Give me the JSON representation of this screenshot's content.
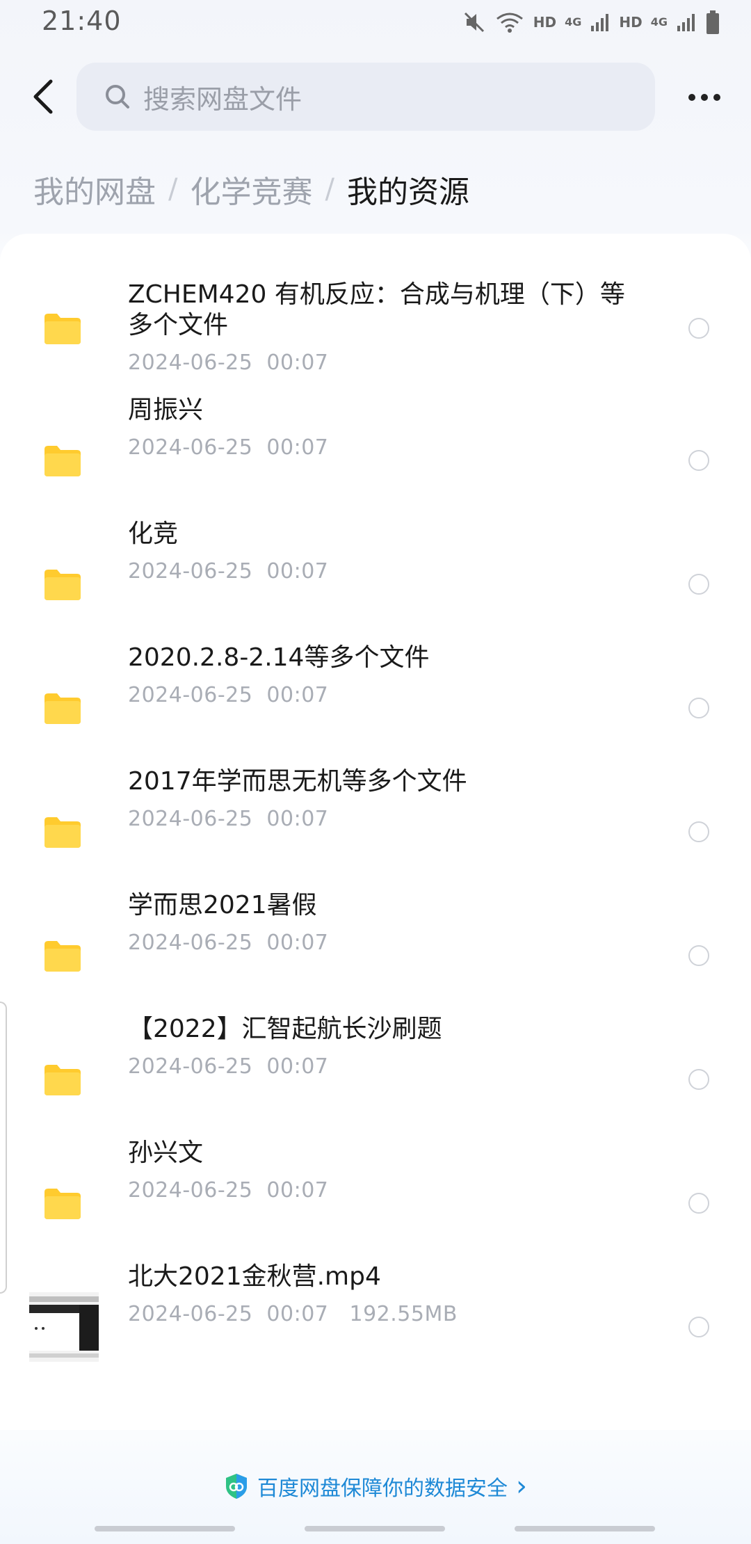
{
  "status_bar": {
    "time": "21:40",
    "hd_1": "HD",
    "net_1": "4G",
    "hd_2": "HD",
    "net_2": "4G"
  },
  "search": {
    "placeholder": "搜索网盘文件"
  },
  "breadcrumb": {
    "items": [
      "我的网盘",
      "化学竞赛",
      "我的资源"
    ]
  },
  "files": [
    {
      "name": "ZCHEM420 有机反应：合成与机理（下）等多个文件",
      "date": "2024-06-25  00:07",
      "type": "folder",
      "icon": "folder-icon"
    },
    {
      "name": "周振兴",
      "date": "2024-06-25  00:07",
      "type": "folder",
      "icon": "folder-icon"
    },
    {
      "name": "化竞",
      "date": "2024-06-25  00:07",
      "type": "folder",
      "icon": "folder-icon"
    },
    {
      "name": "2020.2.8-2.14等多个文件",
      "date": "2024-06-25  00:07",
      "type": "folder",
      "icon": "folder-icon"
    },
    {
      "name": "2017年学而思无机等多个文件",
      "date": "2024-06-25  00:07",
      "type": "folder",
      "icon": "folder-icon"
    },
    {
      "name": "学而思2021暑假",
      "date": "2024-06-25  00:07",
      "type": "folder",
      "icon": "folder-icon"
    },
    {
      "name": "【2022】汇智起航长沙刷题",
      "date": "2024-06-25  00:07",
      "type": "folder",
      "icon": "folder-icon"
    },
    {
      "name": "孙兴文",
      "date": "2024-06-25  00:07",
      "type": "folder",
      "icon": "folder-icon"
    },
    {
      "name": "北大2021金秋营.mp4",
      "date": "2024-06-25  00:07   192.55MB",
      "type": "video",
      "icon": "video-thumbnail"
    }
  ],
  "footer": {
    "text": "百度网盘保障你的数据安全",
    "arrow": "›"
  },
  "colors": {
    "folder": "#ffd84d",
    "folder_tab": "#ffcb2e",
    "accent": "#1e89d6",
    "meta_text": "#a9adb5"
  }
}
